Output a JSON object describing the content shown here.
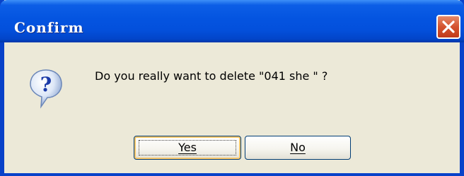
{
  "window": {
    "title": "Confirm",
    "close_icon": "close-icon"
  },
  "dialog": {
    "icon": "question-icon",
    "message": "Do you really want to delete \"041 she \" ?"
  },
  "buttons": {
    "yes_label": "Yes",
    "no_label": "No"
  },
  "colors": {
    "titlebar": "#0454e0",
    "border": "#0842c9",
    "body": "#ece9d8",
    "close_button": "#d4532e",
    "default_button_highlight": "#f9c76a"
  }
}
